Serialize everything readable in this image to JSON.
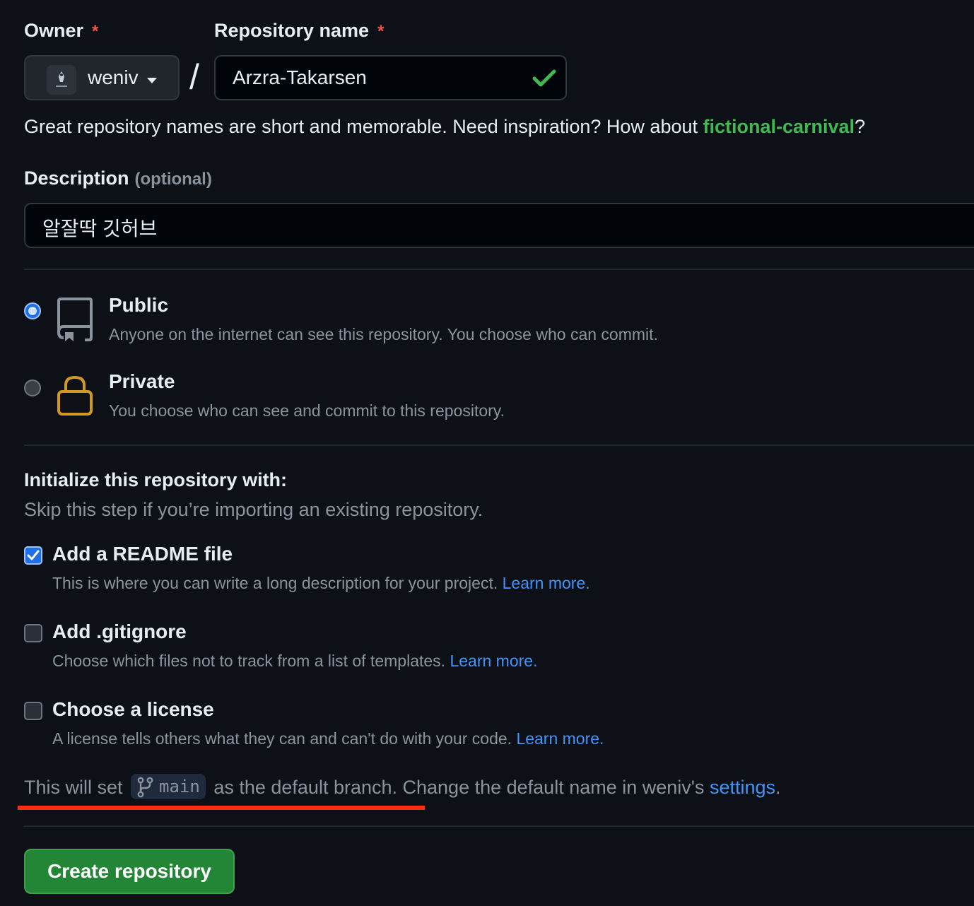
{
  "owner": {
    "label": "Owner",
    "required_mark": "*",
    "selected": "weniv",
    "avatar_text": "weniv"
  },
  "repo_name": {
    "label": "Repository name",
    "required_mark": "*",
    "separator": "/",
    "value": "Arzra-Takarsen",
    "valid_icon": "check-icon"
  },
  "hint": {
    "prefix": "Great repository names are short and memorable. Need inspiration? How about ",
    "suggestion": "fictional-carnival",
    "suffix": "?"
  },
  "description": {
    "label": "Description",
    "optional": "(optional)",
    "value": "알잘딱 깃허브"
  },
  "visibility": {
    "options": [
      {
        "title": "Public",
        "desc": "Anyone on the internet can see this repository. You choose who can commit.",
        "icon": "repo-icon",
        "selected": true
      },
      {
        "title": "Private",
        "desc": "You choose who can see and commit to this repository.",
        "icon": "lock-icon",
        "selected": false
      }
    ]
  },
  "init": {
    "title": "Initialize this repository with:",
    "subtitle": "Skip this step if you’re importing an existing repository.",
    "items": [
      {
        "title": "Add a README file",
        "desc": "This is where you can write a long description for your project. ",
        "link": "Learn more.",
        "checked": true
      },
      {
        "title": "Add .gitignore",
        "desc": "Choose which files not to track from a list of templates. ",
        "link": "Learn more.",
        "checked": false
      },
      {
        "title": "Choose a license",
        "desc": "A license tells others what they can and can't do with your code. ",
        "link": "Learn more.",
        "checked": false
      }
    ]
  },
  "branch": {
    "prefix": "This will set ",
    "name": "main",
    "middle": " as the default branch. Change the default name in weniv's ",
    "link": "settings",
    "suffix": "."
  },
  "create_button": "Create repository",
  "colors": {
    "background": "#0d1117",
    "accent_green": "#238636",
    "link_blue": "#4493f8",
    "suggestion_green": "#3fb950",
    "required_red": "#f85149",
    "annotation_red": "#ff2d12"
  }
}
